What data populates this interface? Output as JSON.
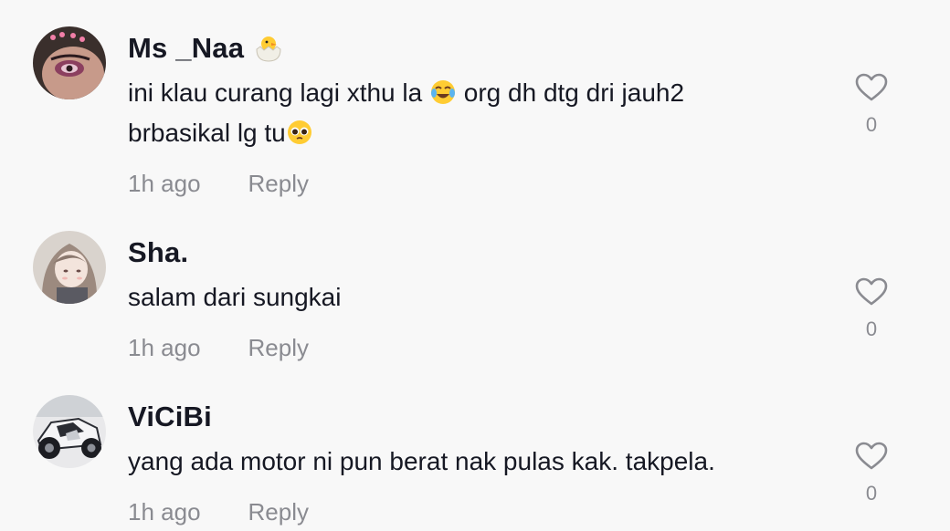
{
  "comments": [
    {
      "username": "Ms _Naa",
      "username_emoji": "hatching-chick-emoji",
      "text_line1_a": "ini klau curang lagi xthu la",
      "text_line1_emoji": "joy-emoji",
      "text_line1_b": "org dh dtg dri jauh2",
      "text_line2": "brbasikal lg tu",
      "text_line2_emoji": "pleading-face-emoji",
      "time": "1h ago",
      "reply_label": "Reply",
      "likes": "0"
    },
    {
      "username": "Sha.",
      "text": "salam dari sungkai",
      "time": "1h ago",
      "reply_label": "Reply",
      "likes": "0"
    },
    {
      "username": "ViCiBi",
      "text": "yang ada motor ni pun berat nak pulas kak. takpela.",
      "time": "1h ago",
      "reply_label": "Reply",
      "likes": "0"
    }
  ],
  "icons": {
    "like": "heart-outline-icon"
  },
  "colors": {
    "background": "#f8f8f8",
    "primary_text": "#161823",
    "secondary_text": "#8a8b91"
  }
}
